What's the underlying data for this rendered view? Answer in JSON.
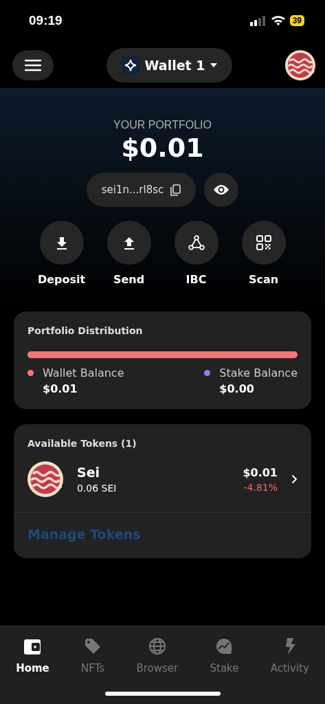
{
  "status_bar": {
    "time": "09:19",
    "battery": "39"
  },
  "header": {
    "wallet": "Wallet 1"
  },
  "portfolio": {
    "label": "YOUR PORTFOLIO",
    "value": "$0.01",
    "address": "sei1n...rl8sc"
  },
  "actions": [
    {
      "kind": "deposit",
      "label": "Deposit"
    },
    {
      "kind": "send",
      "label": "Send"
    },
    {
      "kind": "ibc",
      "label": "IBC"
    },
    {
      "kind": "scan",
      "label": "Scan"
    }
  ],
  "distribution": {
    "title": "Portfolio Distribution",
    "level": 1,
    "legend": [
      {
        "label": "Wallet Balance",
        "value": "$0.01",
        "color": "#fa7373"
      },
      {
        "label": "Stake Balance",
        "value": "$0.00",
        "color": "#8081f0"
      }
    ]
  },
  "tokens": {
    "title": "Available Tokens (1)",
    "items": [
      {
        "name": "Sei",
        "amount": "0.06 SEI",
        "value": "$0.01",
        "change": "-4.81%"
      }
    ],
    "manage": "Manage Tokens"
  },
  "tabs": [
    {
      "kind": "home",
      "label": "Home",
      "selected": true
    },
    {
      "kind": "nfts",
      "label": "NFTs",
      "selected": false
    },
    {
      "kind": "browser",
      "label": "Browser",
      "selected": false
    },
    {
      "kind": "stake",
      "label": "Stake",
      "selected": false
    },
    {
      "kind": "activity",
      "label": "Activity",
      "selected": false
    }
  ]
}
